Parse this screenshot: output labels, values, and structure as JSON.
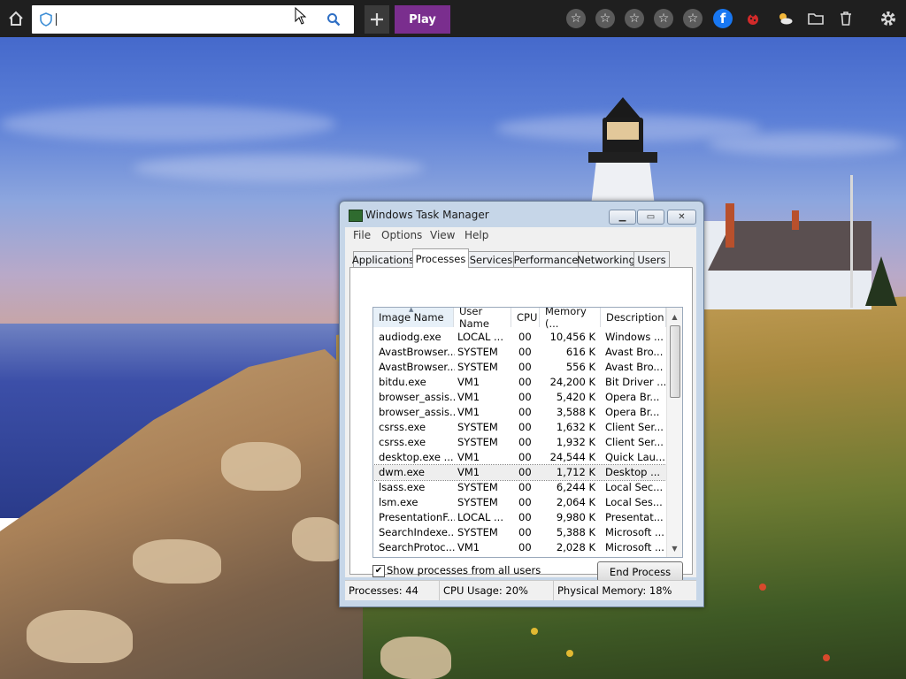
{
  "toolbar": {
    "home_icon": "home-icon",
    "search": {
      "value": "",
      "placeholder": ""
    },
    "add_icon": "plus-icon",
    "play_label": "Play",
    "right_icons": [
      "star-icon",
      "star-icon",
      "star-icon",
      "star-icon",
      "star-icon",
      "facebook-icon",
      "ladybug-icon",
      "weather-icon",
      "folder-icon",
      "trash-icon",
      "gear-icon"
    ]
  },
  "colors": {
    "play_button": "#7a2e8e",
    "toolbar_bg": "#1f1f1f",
    "facebook": "#1877f2"
  },
  "task_manager": {
    "title": "Windows Task Manager",
    "menu": [
      "File",
      "Options",
      "View",
      "Help"
    ],
    "tabs": [
      "Applications",
      "Processes",
      "Services",
      "Performance",
      "Networking",
      "Users"
    ],
    "active_tab": "Processes",
    "columns": [
      "Image Name",
      "User Name",
      "CPU",
      "Memory (...",
      "Description"
    ],
    "processes": [
      {
        "name": "audiodg.exe",
        "user": "LOCAL ...",
        "cpu": "00",
        "mem": "10,456 K",
        "desc": "Windows ..."
      },
      {
        "name": "AvastBrowser...",
        "user": "SYSTEM",
        "cpu": "00",
        "mem": "616 K",
        "desc": "Avast Bro..."
      },
      {
        "name": "AvastBrowser...",
        "user": "SYSTEM",
        "cpu": "00",
        "mem": "556 K",
        "desc": "Avast Bro..."
      },
      {
        "name": "bitdu.exe",
        "user": "VM1",
        "cpu": "00",
        "mem": "24,200 K",
        "desc": "Bit Driver ..."
      },
      {
        "name": "browser_assis...",
        "user": "VM1",
        "cpu": "00",
        "mem": "5,420 K",
        "desc": "Opera Br..."
      },
      {
        "name": "browser_assis...",
        "user": "VM1",
        "cpu": "00",
        "mem": "3,588 K",
        "desc": "Opera Br..."
      },
      {
        "name": "csrss.exe",
        "user": "SYSTEM",
        "cpu": "00",
        "mem": "1,632 K",
        "desc": "Client Ser..."
      },
      {
        "name": "csrss.exe",
        "user": "SYSTEM",
        "cpu": "00",
        "mem": "1,932 K",
        "desc": "Client Ser..."
      },
      {
        "name": "desktop.exe ...",
        "user": "VM1",
        "cpu": "00",
        "mem": "24,544 K",
        "desc": "Quick Lau..."
      },
      {
        "name": "dwm.exe",
        "user": "VM1",
        "cpu": "00",
        "mem": "1,712 K",
        "desc": "Desktop ..."
      },
      {
        "name": "lsass.exe",
        "user": "SYSTEM",
        "cpu": "00",
        "mem": "6,244 K",
        "desc": "Local Sec..."
      },
      {
        "name": "lsm.exe",
        "user": "SYSTEM",
        "cpu": "00",
        "mem": "2,064 K",
        "desc": "Local Ses..."
      },
      {
        "name": "PresentationF...",
        "user": "LOCAL ...",
        "cpu": "00",
        "mem": "9,980 K",
        "desc": "Presentat..."
      },
      {
        "name": "SearchIndexe...",
        "user": "SYSTEM",
        "cpu": "00",
        "mem": "5,388 K",
        "desc": "Microsoft ..."
      },
      {
        "name": "SearchProtoc...",
        "user": "VM1",
        "cpu": "00",
        "mem": "2,028 K",
        "desc": "Microsoft ..."
      }
    ],
    "selected_process": "dwm.exe",
    "show_all_users": {
      "checked": true,
      "label": "Show processes from all users"
    },
    "end_process_label": "End Process",
    "status": {
      "processes": "Processes: 44",
      "cpu_usage": "CPU Usage: 20%",
      "physical_memory": "Physical Memory: 18%"
    }
  }
}
